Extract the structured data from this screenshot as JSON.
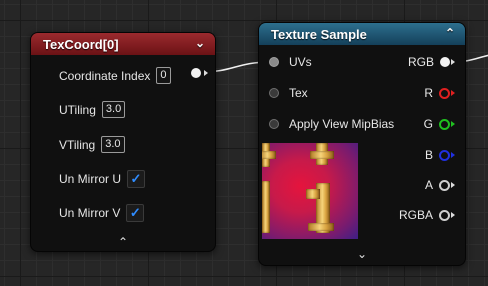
{
  "texcoord_node": {
    "title": "TexCoord[0]",
    "rows": [
      {
        "label": "Coordinate Index",
        "value": "0",
        "kind": "value"
      },
      {
        "label": "UTiling",
        "value": "3.0",
        "kind": "value"
      },
      {
        "label": "VTiling",
        "value": "3.0",
        "kind": "value"
      },
      {
        "label": "Un Mirror U",
        "checked": true,
        "kind": "checkbox"
      },
      {
        "label": "Un Mirror V",
        "checked": true,
        "kind": "checkbox"
      }
    ],
    "header_color": "#8b1e22"
  },
  "texture_sample_node": {
    "title": "Texture Sample",
    "inputs": [
      "UVs",
      "Tex",
      "Apply View MipBias"
    ],
    "outputs": [
      {
        "label": "RGB",
        "color": "#f2f2f2"
      },
      {
        "label": "R",
        "color": "#e02020"
      },
      {
        "label": "G",
        "color": "#20c020"
      },
      {
        "label": "B",
        "color": "#2030e0"
      },
      {
        "label": "A",
        "color": "#cfcfcf"
      },
      {
        "label": "RGBA",
        "color": "#f2f2f2"
      }
    ],
    "header_color": "#1f5a78"
  },
  "icons": {
    "collapse": "chevron-down-icon",
    "expand": "chevron-up-icon",
    "check": "checkmark-icon"
  }
}
